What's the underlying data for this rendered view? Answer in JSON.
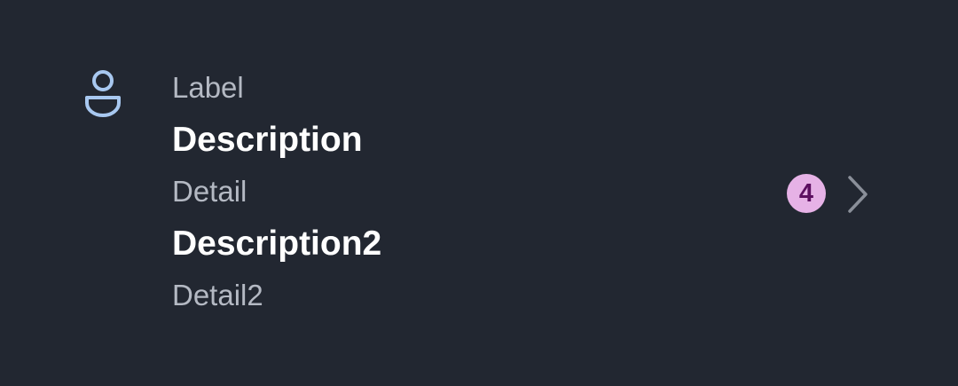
{
  "list_item": {
    "icon": "person-icon",
    "label": "Label",
    "description": "Description",
    "detail": "Detail",
    "description2": "Description2",
    "detail2": "Detail2",
    "badge_count": "4",
    "trailing_icon": "chevron-right-icon"
  },
  "colors": {
    "background": "#222731",
    "icon": "#a8c8f0",
    "badge_bg": "#e6b2e6",
    "badge_text": "#5c0f60"
  }
}
